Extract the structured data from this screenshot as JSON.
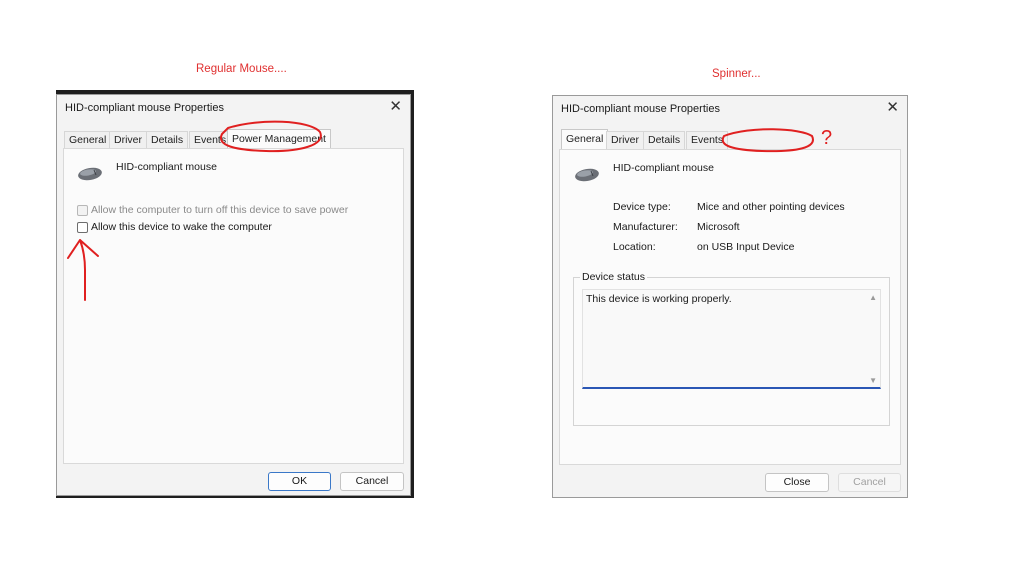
{
  "captions": {
    "left": "Regular Mouse....",
    "right": "Spinner..."
  },
  "left_dialog": {
    "title": "HID-compliant mouse Properties",
    "tabs": [
      "General",
      "Driver",
      "Details",
      "Events",
      "Power Management"
    ],
    "active_tab": "Power Management",
    "device_name": "HID-compliant mouse",
    "options": [
      {
        "label": "Allow the computer to turn off this device to save power",
        "checked": false,
        "enabled": false
      },
      {
        "label": "Allow this device to wake the computer",
        "checked": false,
        "enabled": true
      }
    ],
    "ok_label": "OK",
    "cancel_label": "Cancel"
  },
  "right_dialog": {
    "title": "HID-compliant mouse Properties",
    "tabs": [
      "General",
      "Driver",
      "Details",
      "Events"
    ],
    "active_tab": "General",
    "device_name": "HID-compliant mouse",
    "properties": [
      {
        "key": "Device type:",
        "value": "Mice and other pointing devices"
      },
      {
        "key": "Manufacturer:",
        "value": "Microsoft"
      },
      {
        "key": "Location:",
        "value": "on USB Input Device"
      }
    ],
    "status_group_label": "Device status",
    "status_text": "This device is working properly.",
    "close_label": "Close",
    "cancel_label": "Cancel"
  },
  "annotations": {
    "question_mark": "?"
  },
  "colors": {
    "annotation": "#e02020",
    "accent": "#2b57b5"
  },
  "icons": {
    "device": "mouse-icon",
    "close": "close-icon"
  }
}
